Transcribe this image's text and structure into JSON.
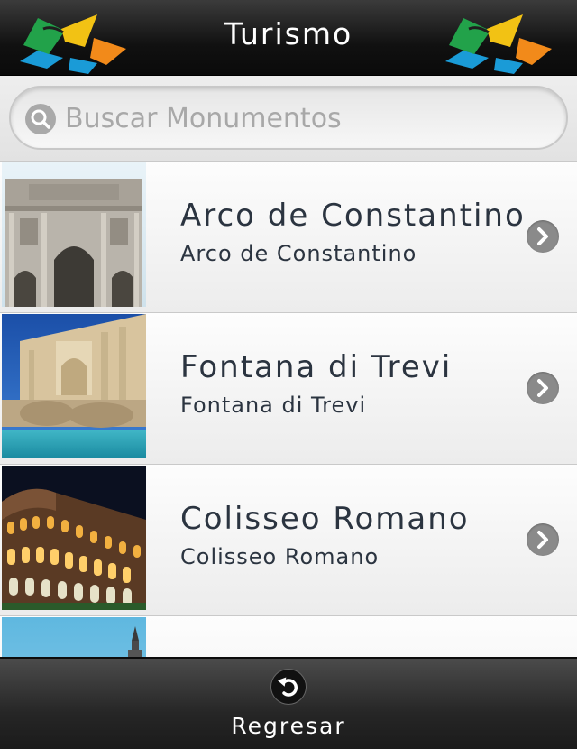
{
  "header": {
    "title": "Turismo",
    "logo_icon": "kites-logo-icon"
  },
  "search": {
    "placeholder": "Buscar Monumentos",
    "value": "",
    "icon": "search-icon"
  },
  "monuments": [
    {
      "title": "Arco de Constantino",
      "subtitle": "Arco de Constantino",
      "thumb": "arch-photo"
    },
    {
      "title": "Fontana di Trevi",
      "subtitle": "Fontana di Trevi",
      "thumb": "fountain-photo"
    },
    {
      "title": "Colisseo Romano",
      "subtitle": "Colisseo Romano",
      "thumb": "colosseum-photo"
    },
    {
      "title": "",
      "subtitle": "",
      "thumb": "tower-photo"
    }
  ],
  "footer": {
    "back_label": "Regresar",
    "back_icon": "undo-arrow-icon"
  },
  "colors": {
    "header_bg": "#111111",
    "list_text": "#2b3440",
    "chevron": "#8a8a8a",
    "logo_green": "#22a24a",
    "logo_yellow": "#f2c214",
    "logo_orange": "#f28a1a",
    "logo_blue": "#1a9bd7"
  }
}
